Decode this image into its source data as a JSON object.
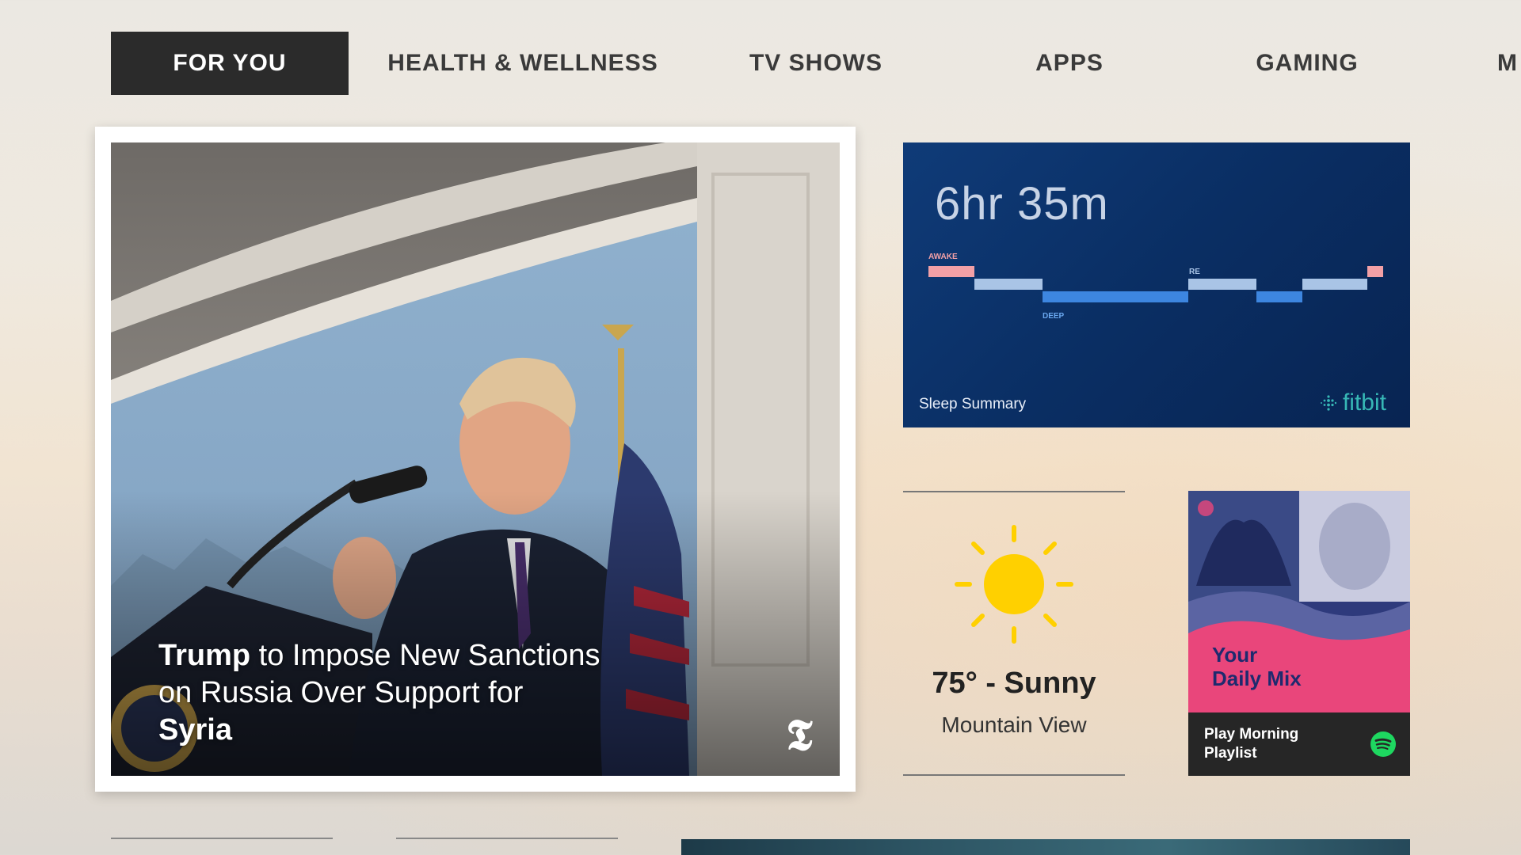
{
  "nav": {
    "tabs": [
      {
        "label": "FOR YOU",
        "active": true
      },
      {
        "label": "HEALTH & WELLNESS",
        "active": false
      },
      {
        "label": "TV SHOWS",
        "active": false
      },
      {
        "label": "APPS",
        "active": false
      },
      {
        "label": "GAMING",
        "active": false
      },
      {
        "label": "M",
        "active": false
      }
    ]
  },
  "news": {
    "headline_bold_1": "Trump",
    "headline_mid": " to Impose New Sanctions on Russia Over Support for ",
    "headline_bold_2": "Syria",
    "publisher_icon": "nyt-logo-icon"
  },
  "fitbit": {
    "duration": "6hr 35m",
    "stage_awake": "AWAKE",
    "stage_rem": "RE",
    "stage_deep": "DEEP",
    "title": "Sleep Summary",
    "brand": "fitbit",
    "colors": {
      "awake": "#f2a0a6",
      "light": "#a9c4e6",
      "deep": "#3d86e0",
      "brand": "#37b8b6"
    }
  },
  "weather": {
    "temp": "75° - Sunny",
    "location": "Mountain View",
    "icon": "sun-icon",
    "sun_color": "#ffd000"
  },
  "spotify": {
    "mix_line1": "Your",
    "mix_line2": "Daily Mix",
    "cta": "Play Morning Playlist",
    "icon": "spotify-icon",
    "colors": {
      "card": "#e9467b",
      "footer": "#262626",
      "logo": "#1ed760"
    }
  }
}
